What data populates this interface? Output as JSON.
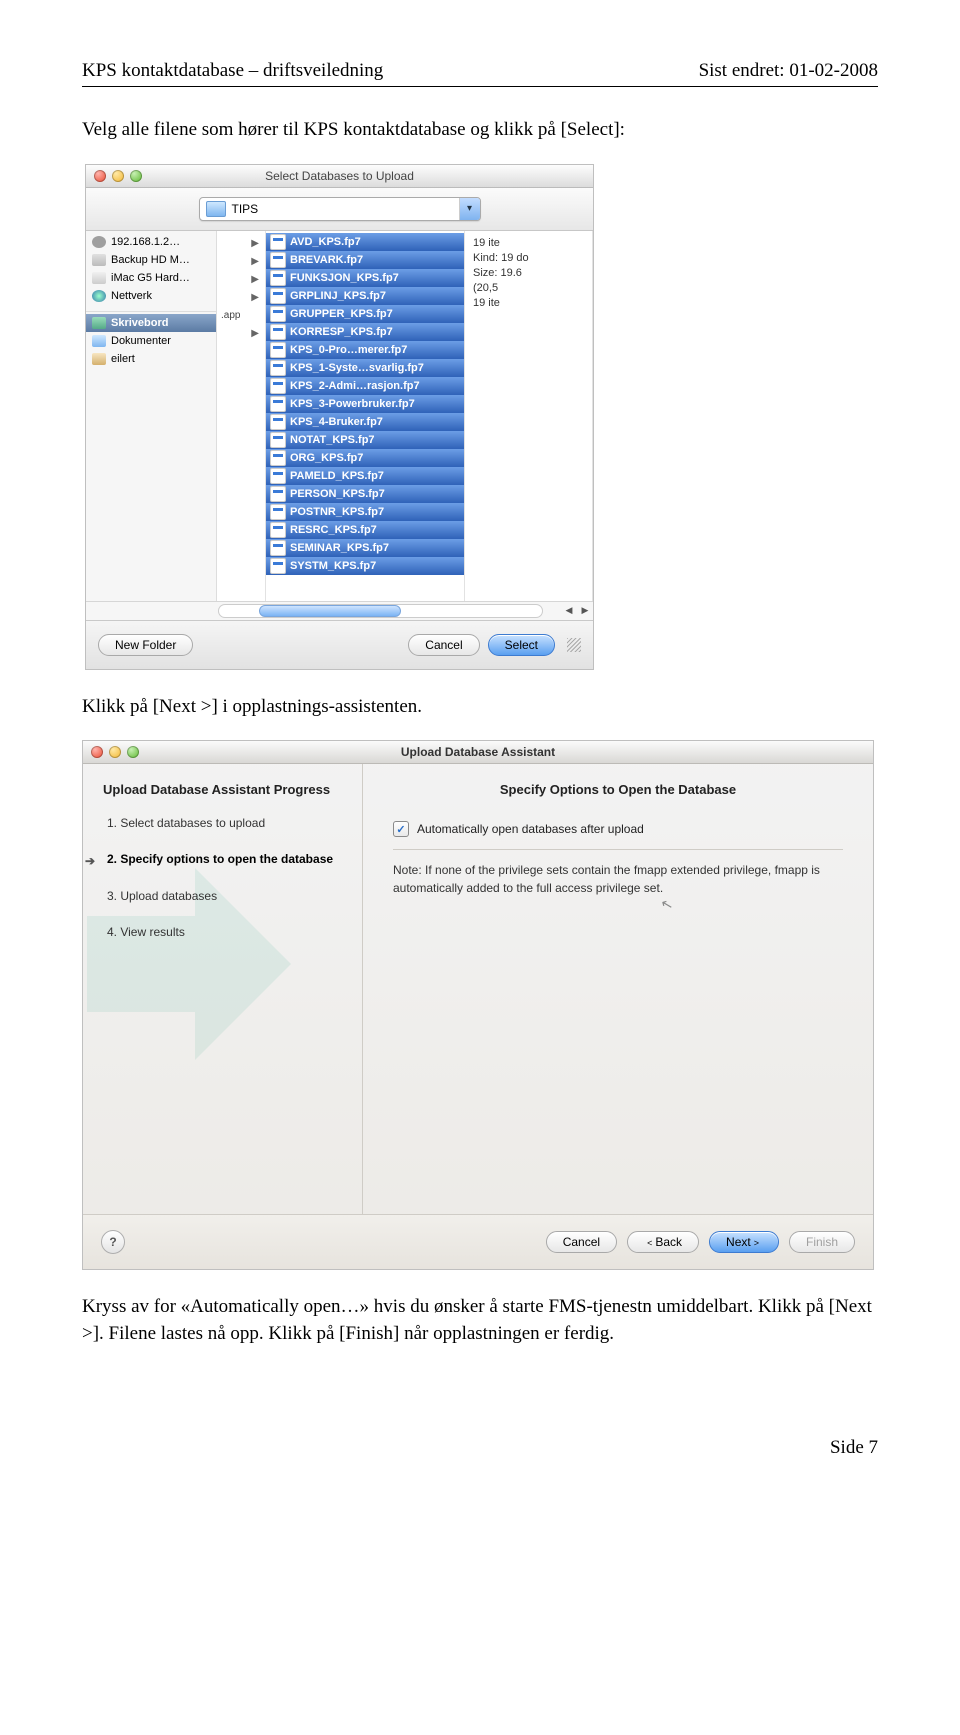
{
  "header": {
    "left": "KPS kontaktdatabase – driftsveiledning",
    "right": "Sist endret: 01-02-2008"
  },
  "para1": "Velg alle filene som hører til KPS kontaktdatabase og klikk på [Select]:",
  "para2": "Klikk på [Next >] i opplastnings-assistenten.",
  "para3": "Kryss av for «Automatically open…» hvis du ønsker å starte FMS-tjenestn umiddelbart. Klikk på [Next >]. Filene lastes nå opp. Klikk på [Finish] når opplastningen er ferdig.",
  "footer": "Side 7",
  "dlg1": {
    "title": "Select Databases to Upload",
    "path": "TIPS",
    "sidebar": [
      {
        "label": "192.168.1.2…",
        "icon": "ico-net"
      },
      {
        "label": "Backup HD M…",
        "icon": "ico-hd"
      },
      {
        "label": "iMac G5 Hard…",
        "icon": "ico-mac"
      },
      {
        "label": "Nettverk",
        "icon": "ico-globe"
      }
    ],
    "sidebar2": [
      {
        "label": "Skrivebord",
        "icon": "ico-desk",
        "sel": true
      },
      {
        "label": "Dokumenter",
        "icon": "ico-docs"
      },
      {
        "label": "eilert",
        "icon": "ico-home"
      }
    ],
    "colA_extra": ".app",
    "files": [
      "AVD_KPS.fp7",
      "BREVARK.fp7",
      "FUNKSJON_KPS.fp7",
      "GRPLINJ_KPS.fp7",
      "GRUPPER_KPS.fp7",
      "KORRESP_KPS.fp7",
      "KPS_0-Pro…merer.fp7",
      "KPS_1-Syste…svarlig.fp7",
      "KPS_2-Admi…rasjon.fp7",
      "KPS_3-Powerbruker.fp7",
      "KPS_4-Bruker.fp7",
      "NOTAT_KPS.fp7",
      "ORG_KPS.fp7",
      "PAMELD_KPS.fp7",
      "PERSON_KPS.fp7",
      "POSTNR_KPS.fp7",
      "RESRC_KPS.fp7",
      "SEMINAR_KPS.fp7",
      "SYSTM_KPS.fp7"
    ],
    "details": {
      "l1": "19 ite",
      "l2": "Kind: 19 do",
      "l3": "Size: 19.6",
      "l4": "(20,5",
      "l5": "19 ite"
    },
    "buttons": {
      "newfolder": "New Folder",
      "cancel": "Cancel",
      "select": "Select"
    }
  },
  "dlg2": {
    "title": "Upload Database Assistant",
    "side_title": "Upload Database Assistant Progress",
    "steps": [
      "1. Select databases to upload",
      "2. Specify options to open the database",
      "3. Upload databases",
      "4. View results"
    ],
    "main_title": "Specify Options to Open the Database",
    "checkbox": "Automatically open databases after upload",
    "note": "Note: If none of the privilege sets contain the fmapp extended privilege, fmapp is automatically added to the full access privilege set.",
    "buttons": {
      "cancel": "Cancel",
      "back": "Back",
      "next": "Next",
      "finish": "Finish"
    }
  }
}
